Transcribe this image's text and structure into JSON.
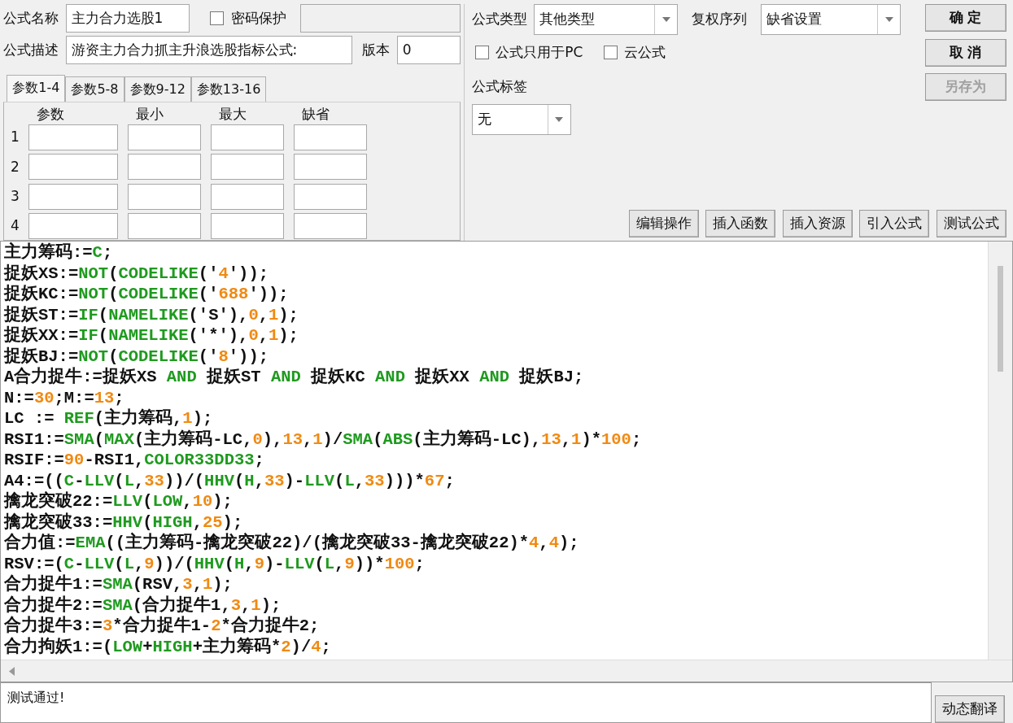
{
  "name_field": {
    "label": "公式名称",
    "value": "主力合力选股1"
  },
  "password": {
    "label": "密码保护",
    "checked": false
  },
  "password_field": {
    "disabled": true
  },
  "description": {
    "label": "公式描述",
    "value": "游资主力合力抓主升浪选股指标公式:"
  },
  "version": {
    "label": "版本",
    "value": "0"
  },
  "param_tabs": [
    {
      "label": "参数1-4",
      "selected": true
    },
    {
      "label": "参数5-8",
      "selected": false
    },
    {
      "label": "参数9-12",
      "selected": false
    },
    {
      "label": "参数13-16",
      "selected": false
    }
  ],
  "param_columns": [
    "参数",
    "最小",
    "最大",
    "缺省"
  ],
  "param_rows": [
    "1",
    "2",
    "3",
    "4"
  ],
  "formula_type": {
    "label": "公式类型",
    "value": "其他类型"
  },
  "adjust": {
    "label": "复权序列",
    "value": "缺省设置"
  },
  "options": [
    {
      "label": "公式只用于PC",
      "checked": false
    },
    {
      "label": "云公式",
      "checked": false
    }
  ],
  "tag": {
    "label": "公式标签",
    "value": "无"
  },
  "side_buttons": [
    {
      "label": "确 定",
      "disabled": false
    },
    {
      "label": "取 消",
      "disabled": false
    },
    {
      "label": "另存为",
      "disabled": true
    }
  ],
  "tool_buttons": [
    "编辑操作",
    "插入函数",
    "插入资源",
    "引入公式",
    "测试公式"
  ],
  "code_lines": [
    [
      {
        "kind": "text",
        "text": "主力筹码:="
      },
      {
        "kind": "func",
        "text": "C"
      },
      {
        "kind": "text",
        "text": ";"
      }
    ],
    [
      {
        "kind": "text",
        "text": "捉妖XS:="
      },
      {
        "kind": "func",
        "text": "NOT"
      },
      {
        "kind": "text",
        "text": "("
      },
      {
        "kind": "func",
        "text": "CODELIKE"
      },
      {
        "kind": "text",
        "text": "('"
      },
      {
        "kind": "num",
        "text": "4"
      },
      {
        "kind": "text",
        "text": "'));"
      }
    ],
    [
      {
        "kind": "text",
        "text": "捉妖KC:="
      },
      {
        "kind": "func",
        "text": "NOT"
      },
      {
        "kind": "text",
        "text": "("
      },
      {
        "kind": "func",
        "text": "CODELIKE"
      },
      {
        "kind": "text",
        "text": "('"
      },
      {
        "kind": "num",
        "text": "688"
      },
      {
        "kind": "text",
        "text": "'));"
      }
    ],
    [
      {
        "kind": "text",
        "text": "捉妖ST:="
      },
      {
        "kind": "func",
        "text": "IF"
      },
      {
        "kind": "text",
        "text": "("
      },
      {
        "kind": "func",
        "text": "NAMELIKE"
      },
      {
        "kind": "text",
        "text": "('S'),"
      },
      {
        "kind": "num",
        "text": "0"
      },
      {
        "kind": "text",
        "text": ","
      },
      {
        "kind": "num",
        "text": "1"
      },
      {
        "kind": "text",
        "text": ");"
      }
    ],
    [
      {
        "kind": "text",
        "text": "捉妖XX:="
      },
      {
        "kind": "func",
        "text": "IF"
      },
      {
        "kind": "text",
        "text": "("
      },
      {
        "kind": "func",
        "text": "NAMELIKE"
      },
      {
        "kind": "text",
        "text": "('*'),"
      },
      {
        "kind": "num",
        "text": "0"
      },
      {
        "kind": "text",
        "text": ","
      },
      {
        "kind": "num",
        "text": "1"
      },
      {
        "kind": "text",
        "text": ");"
      }
    ],
    [
      {
        "kind": "text",
        "text": "捉妖BJ:="
      },
      {
        "kind": "func",
        "text": "NOT"
      },
      {
        "kind": "text",
        "text": "("
      },
      {
        "kind": "func",
        "text": "CODELIKE"
      },
      {
        "kind": "text",
        "text": "('"
      },
      {
        "kind": "num",
        "text": "8"
      },
      {
        "kind": "text",
        "text": "'));"
      }
    ],
    [
      {
        "kind": "text",
        "text": "A合力捉牛:=捉妖XS "
      },
      {
        "kind": "func",
        "text": "AND"
      },
      {
        "kind": "text",
        "text": " 捉妖ST "
      },
      {
        "kind": "func",
        "text": "AND"
      },
      {
        "kind": "text",
        "text": " 捉妖KC "
      },
      {
        "kind": "func",
        "text": "AND"
      },
      {
        "kind": "text",
        "text": " 捉妖XX "
      },
      {
        "kind": "func",
        "text": "AND"
      },
      {
        "kind": "text",
        "text": " 捉妖BJ;"
      }
    ],
    [
      {
        "kind": "text",
        "text": "N:="
      },
      {
        "kind": "num",
        "text": "30"
      },
      {
        "kind": "text",
        "text": ";M:="
      },
      {
        "kind": "num",
        "text": "13"
      },
      {
        "kind": "text",
        "text": ";"
      }
    ],
    [
      {
        "kind": "text",
        "text": "LC := "
      },
      {
        "kind": "func",
        "text": "REF"
      },
      {
        "kind": "text",
        "text": "(主力筹码,"
      },
      {
        "kind": "num",
        "text": "1"
      },
      {
        "kind": "text",
        "text": ");"
      }
    ],
    [
      {
        "kind": "text",
        "text": "RSI1:="
      },
      {
        "kind": "func",
        "text": "SMA"
      },
      {
        "kind": "text",
        "text": "("
      },
      {
        "kind": "func",
        "text": "MAX"
      },
      {
        "kind": "text",
        "text": "(主力筹码-LC,"
      },
      {
        "kind": "num",
        "text": "0"
      },
      {
        "kind": "text",
        "text": "),"
      },
      {
        "kind": "num",
        "text": "13"
      },
      {
        "kind": "text",
        "text": ","
      },
      {
        "kind": "num",
        "text": "1"
      },
      {
        "kind": "text",
        "text": ")/"
      },
      {
        "kind": "func",
        "text": "SMA"
      },
      {
        "kind": "text",
        "text": "("
      },
      {
        "kind": "func",
        "text": "ABS"
      },
      {
        "kind": "text",
        "text": "(主力筹码-LC),"
      },
      {
        "kind": "num",
        "text": "13"
      },
      {
        "kind": "text",
        "text": ","
      },
      {
        "kind": "num",
        "text": "1"
      },
      {
        "kind": "text",
        "text": ")*"
      },
      {
        "kind": "num",
        "text": "100"
      },
      {
        "kind": "text",
        "text": ";"
      }
    ],
    [
      {
        "kind": "text",
        "text": "RSIF:="
      },
      {
        "kind": "num",
        "text": "90"
      },
      {
        "kind": "text",
        "text": "-RSI1,"
      },
      {
        "kind": "func",
        "text": "COLOR33DD33"
      },
      {
        "kind": "text",
        "text": ";"
      }
    ],
    [
      {
        "kind": "text",
        "text": "A4:=(("
      },
      {
        "kind": "func",
        "text": "C"
      },
      {
        "kind": "text",
        "text": "-"
      },
      {
        "kind": "func",
        "text": "LLV"
      },
      {
        "kind": "text",
        "text": "("
      },
      {
        "kind": "func",
        "text": "L"
      },
      {
        "kind": "text",
        "text": ","
      },
      {
        "kind": "num",
        "text": "33"
      },
      {
        "kind": "text",
        "text": "))/("
      },
      {
        "kind": "func",
        "text": "HHV"
      },
      {
        "kind": "text",
        "text": "("
      },
      {
        "kind": "func",
        "text": "H"
      },
      {
        "kind": "text",
        "text": ","
      },
      {
        "kind": "num",
        "text": "33"
      },
      {
        "kind": "text",
        "text": ")-"
      },
      {
        "kind": "func",
        "text": "LLV"
      },
      {
        "kind": "text",
        "text": "("
      },
      {
        "kind": "func",
        "text": "L"
      },
      {
        "kind": "text",
        "text": ","
      },
      {
        "kind": "num",
        "text": "33"
      },
      {
        "kind": "text",
        "text": ")))*"
      },
      {
        "kind": "num",
        "text": "67"
      },
      {
        "kind": "text",
        "text": ";"
      }
    ],
    [
      {
        "kind": "text",
        "text": "擒龙突破22:="
      },
      {
        "kind": "func",
        "text": "LLV"
      },
      {
        "kind": "text",
        "text": "("
      },
      {
        "kind": "func",
        "text": "LOW"
      },
      {
        "kind": "text",
        "text": ","
      },
      {
        "kind": "num",
        "text": "10"
      },
      {
        "kind": "text",
        "text": ");"
      }
    ],
    [
      {
        "kind": "text",
        "text": "擒龙突破33:="
      },
      {
        "kind": "func",
        "text": "HHV"
      },
      {
        "kind": "text",
        "text": "("
      },
      {
        "kind": "func",
        "text": "HIGH"
      },
      {
        "kind": "text",
        "text": ","
      },
      {
        "kind": "num",
        "text": "25"
      },
      {
        "kind": "text",
        "text": ");"
      }
    ],
    [
      {
        "kind": "text",
        "text": "合力值:="
      },
      {
        "kind": "func",
        "text": "EMA"
      },
      {
        "kind": "text",
        "text": "((主力筹码-擒龙突破22)/(擒龙突破33-擒龙突破22)*"
      },
      {
        "kind": "num",
        "text": "4"
      },
      {
        "kind": "text",
        "text": ","
      },
      {
        "kind": "num",
        "text": "4"
      },
      {
        "kind": "text",
        "text": ");"
      }
    ],
    [
      {
        "kind": "text",
        "text": "RSV:=("
      },
      {
        "kind": "func",
        "text": "C"
      },
      {
        "kind": "text",
        "text": "-"
      },
      {
        "kind": "func",
        "text": "LLV"
      },
      {
        "kind": "text",
        "text": "("
      },
      {
        "kind": "func",
        "text": "L"
      },
      {
        "kind": "text",
        "text": ","
      },
      {
        "kind": "num",
        "text": "9"
      },
      {
        "kind": "text",
        "text": "))/("
      },
      {
        "kind": "func",
        "text": "HHV"
      },
      {
        "kind": "text",
        "text": "("
      },
      {
        "kind": "func",
        "text": "H"
      },
      {
        "kind": "text",
        "text": ","
      },
      {
        "kind": "num",
        "text": "9"
      },
      {
        "kind": "text",
        "text": ")-"
      },
      {
        "kind": "func",
        "text": "LLV"
      },
      {
        "kind": "text",
        "text": "("
      },
      {
        "kind": "func",
        "text": "L"
      },
      {
        "kind": "text",
        "text": ","
      },
      {
        "kind": "num",
        "text": "9"
      },
      {
        "kind": "text",
        "text": "))*"
      },
      {
        "kind": "num",
        "text": "100"
      },
      {
        "kind": "text",
        "text": ";"
      }
    ],
    [
      {
        "kind": "text",
        "text": "合力捉牛1:="
      },
      {
        "kind": "func",
        "text": "SMA"
      },
      {
        "kind": "text",
        "text": "(RSV,"
      },
      {
        "kind": "num",
        "text": "3"
      },
      {
        "kind": "text",
        "text": ","
      },
      {
        "kind": "num",
        "text": "1"
      },
      {
        "kind": "text",
        "text": ");"
      }
    ],
    [
      {
        "kind": "text",
        "text": "合力捉牛2:="
      },
      {
        "kind": "func",
        "text": "SMA"
      },
      {
        "kind": "text",
        "text": "(合力捉牛1,"
      },
      {
        "kind": "num",
        "text": "3"
      },
      {
        "kind": "text",
        "text": ","
      },
      {
        "kind": "num",
        "text": "1"
      },
      {
        "kind": "text",
        "text": ");"
      }
    ],
    [
      {
        "kind": "text",
        "text": "合力捉牛3:="
      },
      {
        "kind": "num",
        "text": "3"
      },
      {
        "kind": "text",
        "text": "*合力捉牛1-"
      },
      {
        "kind": "num",
        "text": "2"
      },
      {
        "kind": "text",
        "text": "*合力捉牛2;"
      }
    ],
    [
      {
        "kind": "text",
        "text": "合力拘妖1:=("
      },
      {
        "kind": "func",
        "text": "LOW"
      },
      {
        "kind": "text",
        "text": "+"
      },
      {
        "kind": "func",
        "text": "HIGH"
      },
      {
        "kind": "text",
        "text": "+主力筹码*"
      },
      {
        "kind": "num",
        "text": "2"
      },
      {
        "kind": "text",
        "text": ")/"
      },
      {
        "kind": "num",
        "text": "4"
      },
      {
        "kind": "text",
        "text": ";"
      }
    ]
  ],
  "status": "测试通过!",
  "translate_button": "动态翻译"
}
